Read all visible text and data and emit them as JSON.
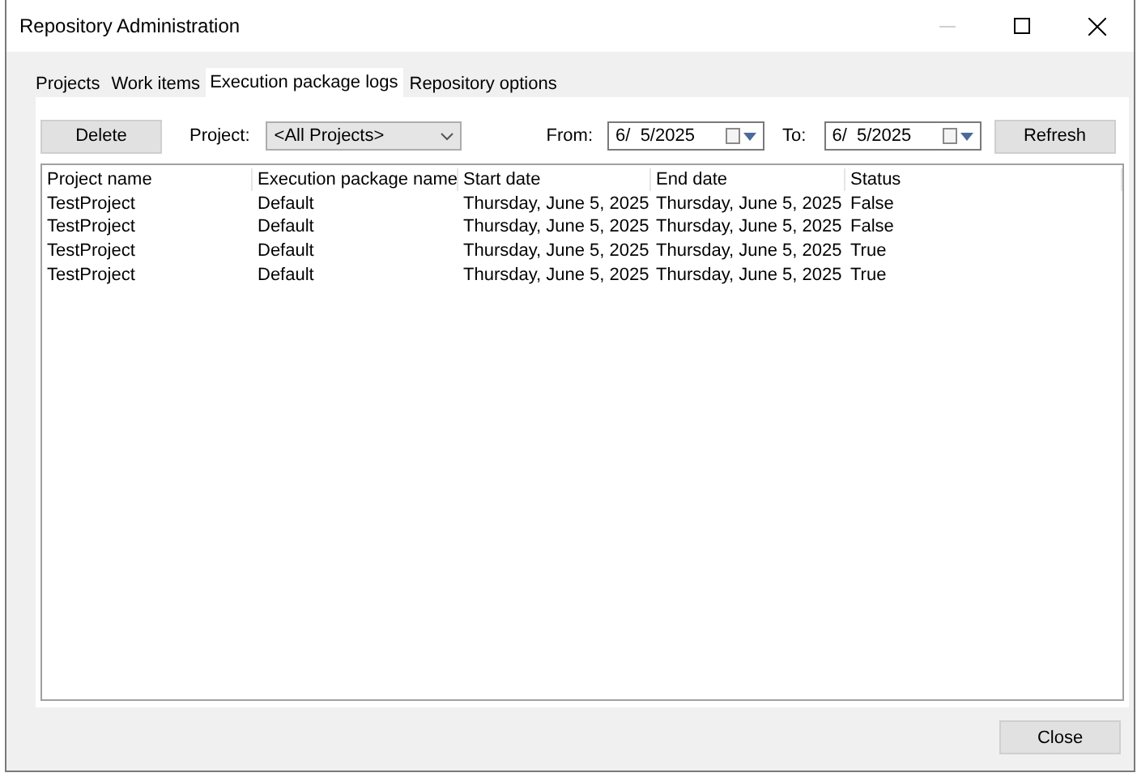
{
  "window": {
    "title": "Repository Administration",
    "minimize_disabled": true
  },
  "tabs": [
    {
      "label": "Projects",
      "selected": false
    },
    {
      "label": "Work items",
      "selected": false
    },
    {
      "label": "Execution package logs",
      "selected": true
    },
    {
      "label": "Repository options",
      "selected": false
    }
  ],
  "toolbar": {
    "delete_button": "Delete",
    "project_label": "Project:",
    "project_value": "<All Projects>",
    "from_label": "From:",
    "from_value": "6/  5/2025",
    "to_label": "To:",
    "to_value": "6/  5/2025",
    "refresh_button": "Refresh"
  },
  "table": {
    "columns": [
      "Project name",
      "Execution package name",
      "Start date",
      "End date",
      "Status"
    ],
    "rows": [
      [
        "TestProject",
        "Default",
        "Thursday, June 5, 2025",
        "Thursday, June 5, 2025",
        "False"
      ],
      [
        "TestProject",
        "Default",
        "Thursday, June 5, 2025",
        "Thursday, June 5, 2025",
        "False"
      ],
      [
        "TestProject",
        "Default",
        "Thursday, June 5, 2025",
        "Thursday, June 5, 2025",
        "True"
      ],
      [
        "TestProject",
        "Default",
        "Thursday, June 5, 2025",
        "Thursday, June 5, 2025",
        "True"
      ]
    ]
  },
  "footer": {
    "close_button": "Close"
  }
}
